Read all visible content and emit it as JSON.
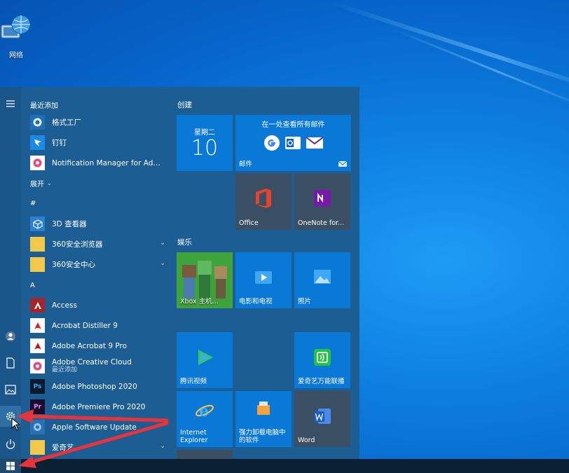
{
  "desktop": {
    "network_icon_label": "网络"
  },
  "start_menu": {
    "recently_added_header": "最近添加",
    "recent_items": [
      {
        "label": "格式工厂"
      },
      {
        "label": "钉钉"
      },
      {
        "label": "Notification Manager for Adobe..."
      }
    ],
    "expand_label": "展开",
    "section_hash": "#",
    "apps_hash": [
      {
        "label": "3D 查看器",
        "expandable": false
      },
      {
        "label": "360安全浏览器",
        "expandable": true
      },
      {
        "label": "360安全中心",
        "expandable": true
      }
    ],
    "section_a": "A",
    "apps_a": [
      {
        "label": "Access"
      },
      {
        "label": "Acrobat Distiller 9"
      },
      {
        "label": "Adobe Acrobat 9 Pro"
      },
      {
        "label": "Adobe Creative Cloud",
        "sub": "最近添加"
      },
      {
        "label": "Adobe Photoshop 2020"
      },
      {
        "label": "Adobe Premiere Pro 2020"
      },
      {
        "label": "Apple Software Update"
      },
      {
        "label": "爱奇艺"
      }
    ],
    "tile_groups": {
      "create": "创建",
      "entertainment": "娱乐"
    },
    "tiles": {
      "calendar_day": "星期二",
      "calendar_date": "10",
      "mail_title": "在一处查看所有邮件",
      "mail_label": "邮件",
      "office": "Office",
      "onenote": "OneNote for...",
      "xbox": "Xbox 主机...",
      "movies": "电影和电视",
      "photos": "照片",
      "tencent_video": "腾讯视频",
      "iqiyi_cast": "爱奇艺万能联播",
      "ie": "Internet Explorer",
      "uninstall": "强力卸载电脑中的软件",
      "word": "Word"
    }
  },
  "colors": {
    "accent_tile": "#0a78d7",
    "start_bg": "#1c5d93",
    "arrow": "#e8333a"
  }
}
